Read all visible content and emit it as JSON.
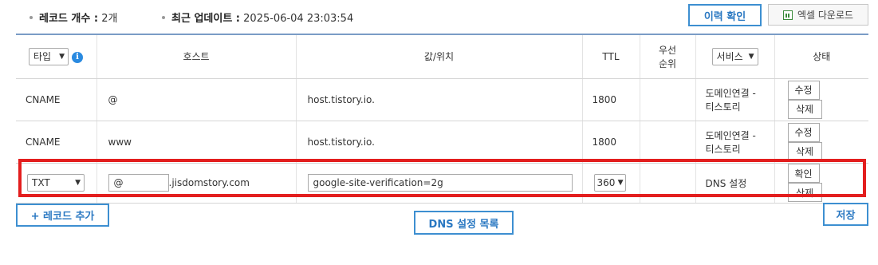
{
  "stats": {
    "record_count_label": "레코드 개수 :",
    "record_count_value": "2개",
    "last_update_label": "최근 업데이트 :",
    "last_update_value": "2025-06-04 23:03:54"
  },
  "actions": {
    "history_label": "이력 확인",
    "excel_label": "엑셀 다운로드",
    "add_record_label": "+ 레코드 추가",
    "dns_list_label": "DNS 설정 목록",
    "save_label": "저장"
  },
  "table": {
    "headers": {
      "type": "타입",
      "host": "호스트",
      "value": "값/위치",
      "ttl": "TTL",
      "priority_line1": "우선",
      "priority_line2": "순위",
      "service": "서비스",
      "status": "상태"
    },
    "rows": [
      {
        "type": "CNAME",
        "host": "@",
        "value": "host.tistory.io.",
        "ttl": "1800",
        "priority": "",
        "service_line1": "도메인연결 -",
        "service_line2": "티스토리",
        "btn1": "수정",
        "btn2": "삭제"
      },
      {
        "type": "CNAME",
        "host": "www",
        "value": "host.tistory.io.",
        "ttl": "1800",
        "priority": "",
        "service_line1": "도메인연결 -",
        "service_line2": "티스토리",
        "btn1": "수정",
        "btn2": "삭제"
      }
    ],
    "edit_row": {
      "type": "TXT",
      "host_input": "@",
      "host_suffix": ".jisdomstory.com",
      "value_input": "google-site-verification=2g",
      "ttl": "360",
      "service": "DNS 설정",
      "btn1": "확인",
      "btn2": "삭제"
    }
  },
  "colors": {
    "accent_blue": "#3d8fd1",
    "highlight_red": "#e31e1e",
    "info_icon": "#2a8ae0"
  }
}
